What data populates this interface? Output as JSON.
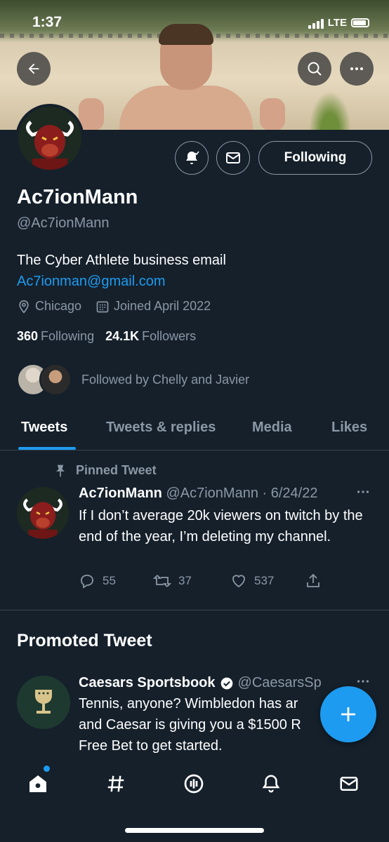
{
  "status_bar": {
    "time": "1:37",
    "network": "LTE"
  },
  "profile": {
    "display_name": "Ac7ionMann",
    "handle": "@Ac7ionMann",
    "bio": "The Cyber Athlete business email",
    "email": "Ac7ionman@gmail.com",
    "location": "Chicago",
    "joined": "Joined April 2022",
    "following_count": "360",
    "following_label": "Following",
    "followers_count": "24.1K",
    "followers_label": "Followers",
    "followed_by": "Followed by Chelly and Javier",
    "following_button": "Following"
  },
  "tabs": [
    {
      "label": "Tweets",
      "active": true
    },
    {
      "label": "Tweets & replies",
      "active": false
    },
    {
      "label": "Media",
      "active": false
    },
    {
      "label": "Likes",
      "active": false
    }
  ],
  "pinned_tweet": {
    "pinned_label": "Pinned Tweet",
    "name": "Ac7ionMann",
    "handle": "@Ac7ionMann",
    "date": "6/24/22",
    "text": "If I don’t average 20k viewers on twitch by the end of the year, I’m deleting my channel.",
    "replies": "55",
    "retweets": "37",
    "likes": "537"
  },
  "promoted": {
    "section_title": "Promoted Tweet",
    "name": "Caesars Sportsbook",
    "handle": "@CaesarsSp",
    "lines": [
      "Tennis, anyone? Wimbledon has ar",
      "and Caesar is giving you a $1500 R",
      "Free Bet to get started."
    ]
  },
  "colors": {
    "accent": "#1d9bf0",
    "background": "#15202b",
    "muted": "#8b98a5",
    "border": "#38444d"
  },
  "icons": {
    "back": "arrow-left-icon",
    "search": "search-icon",
    "more": "more-icon",
    "bell": "bell-icon",
    "mail": "mail-icon",
    "location": "location-icon",
    "calendar": "calendar-icon",
    "pin": "pin-icon",
    "reply": "reply-icon",
    "retweet": "retweet-icon",
    "like": "heart-icon",
    "share": "share-icon",
    "compose": "plus-icon",
    "home": "home-icon",
    "explore": "hashtag-icon",
    "spaces": "spaces-icon",
    "notifications": "bell-icon",
    "messages": "mail-icon"
  }
}
